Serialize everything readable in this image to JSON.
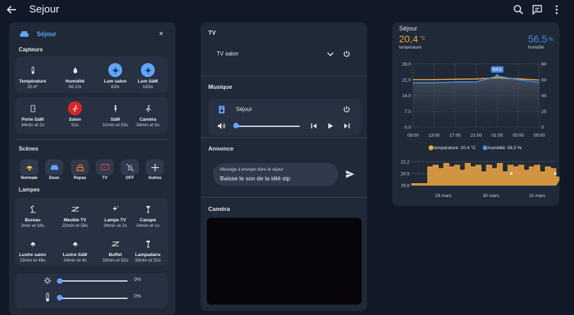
{
  "header": {
    "title": "Sejour"
  },
  "left": {
    "room_title": "Séjour",
    "sensors_title": "Capteurs",
    "sensors_row1": [
      {
        "name": "Température",
        "value": "20.4°",
        "icon": "thermometer-icon"
      },
      {
        "name": "Humidité",
        "value": "56.1%",
        "icon": "water-drop-icon"
      },
      {
        "name": "Lum salon",
        "value": "82lx",
        "icon": "brightness-icon"
      },
      {
        "name": "Lum SàM",
        "value": "142lx",
        "icon": "brightness-icon"
      }
    ],
    "sensors_row2": [
      {
        "name": "Porte SàM",
        "value": "34min et 2s",
        "icon": "door-icon"
      },
      {
        "name": "Salon",
        "value": "52s",
        "icon": "motion-icon"
      },
      {
        "name": "SàM",
        "value": "10min et 53s",
        "icon": "person-icon"
      },
      {
        "name": "Caméra",
        "value": "34min et 5s",
        "icon": "walking-icon"
      }
    ],
    "scenes_title": "Scènes",
    "scenes": [
      {
        "label": "Normale",
        "icon": "ceiling-light-icon"
      },
      {
        "label": "Doux",
        "icon": "sofa-icon"
      },
      {
        "label": "Repas",
        "icon": "meal-icon"
      },
      {
        "label": "TV",
        "icon": "tv-icon"
      },
      {
        "label": "OFF",
        "icon": "light-off-icon"
      },
      {
        "label": "Autres",
        "icon": "plus-icon"
      }
    ],
    "lamps_title": "Lampes",
    "lamps_row1": [
      {
        "name": "Bureau",
        "value": "2min et 34s",
        "icon": "desk-lamp-icon"
      },
      {
        "name": "Meuble TV",
        "value": "23min et 58s",
        "icon": "led-strip-icon"
      },
      {
        "name": "Lampe TV",
        "value": "34min et 2s",
        "icon": "sparkle-icon"
      },
      {
        "name": "Canapé",
        "value": "34min et 1s",
        "icon": "floor-lamp-icon"
      }
    ],
    "lamps_row2": [
      {
        "name": "Lustre salon",
        "value": "23min et 48s",
        "icon": "chandelier-icon"
      },
      {
        "name": "Lustre SàM",
        "value": "24min et 4s",
        "icon": "chandelier-icon"
      },
      {
        "name": "Buffet",
        "value": "33min et 52s",
        "icon": "led-strip-icon"
      },
      {
        "name": "Lampadaire",
        "value": "33min et 52s",
        "icon": "floor-lamp-icon"
      }
    ],
    "slider1": {
      "value": "0%",
      "level": 0
    },
    "slider2": {
      "value": "0%",
      "level": 0
    }
  },
  "middle": {
    "tv_title": "TV",
    "tv_select": "TV salon",
    "music_title": "Musique",
    "music_player": "Séjour",
    "volume_level": 0,
    "announce_title": "Annonce",
    "announce_label": "Message à envoyer dans le séjour",
    "announce_value": "Baisse le son de la télé stp",
    "camera_title": "Caméra"
  },
  "right": {
    "room": "Séjour",
    "temp_value": "20,4",
    "temp_unit": "°C",
    "temp_label": "température",
    "hum_value": "56,5",
    "hum_unit": "%",
    "hum_label": "humidité",
    "legend_temp": "température: 20,4 °C",
    "legend_hum": "humidité: 56,5 %",
    "colors": {
      "temperature": "#f0a742",
      "humidity": "#4a90e2"
    }
  },
  "chart_data": [
    {
      "type": "line",
      "x": [
        "09:00",
        "13:00",
        "17:00",
        "21:00",
        "01:00",
        "05:00",
        "09:00"
      ],
      "series": [
        {
          "name": "température",
          "values": [
            21.0,
            21.0,
            21.2,
            21.3,
            21.8,
            21.4,
            20.8
          ]
        },
        {
          "name": "humidité",
          "values": [
            56,
            56,
            57,
            57,
            64.5,
            60,
            56.5
          ]
        }
      ],
      "ylim_left": [
        0,
        28
      ],
      "ticks_left": [
        "0.0",
        "7.0",
        "14.0",
        "21.0",
        "28.0"
      ],
      "ylim_right": [
        0,
        80
      ],
      "ticks_right": [
        "0",
        "20",
        "40",
        "60",
        "80"
      ],
      "annotation": "64.5"
    },
    {
      "type": "area",
      "x": [
        "29 mars",
        "30 mars",
        "31 mars"
      ],
      "ylim": [
        19.8,
        21.2
      ],
      "ticks": [
        "19.8",
        "20.5",
        "21.2"
      ],
      "values": [
        19.9,
        19.9,
        19.9,
        20.9,
        21.0,
        20.8,
        21.1,
        20.9,
        21.0,
        20.7,
        21.1,
        20.9,
        21.0,
        20.6,
        21.0,
        20.8,
        21.1,
        20.6,
        21.0,
        20.9,
        21.0,
        20.7,
        20.9,
        21.0,
        20.6,
        20.9,
        20.8,
        20.3
      ]
    }
  ]
}
